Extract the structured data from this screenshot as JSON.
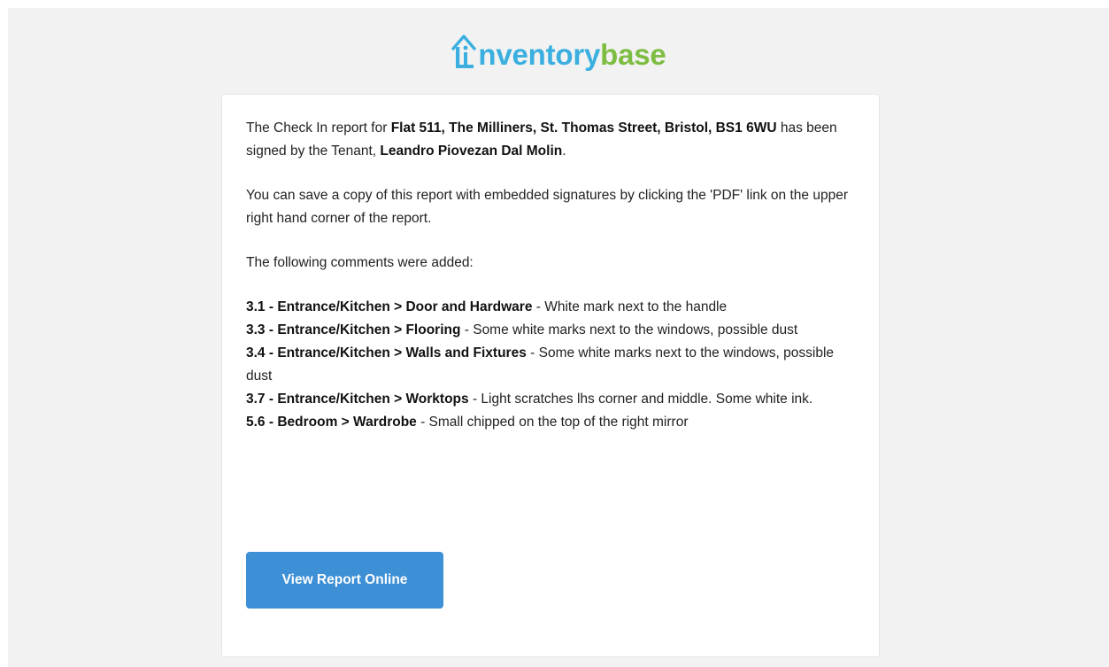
{
  "logo": {
    "part1": "nventory",
    "part2": "base"
  },
  "message": {
    "intro_1": "The Check In report for ",
    "address": "Flat 511, The Milliners, St. Thomas Street, Bristol, BS1 6WU",
    "intro_2": " has been signed by the Tenant, ",
    "tenant": "Leandro Piovezan Dal Molin",
    "intro_3": ".",
    "save_note": "You can save a copy of this report with embedded signatures by clicking the 'PDF' link on the upper right hand corner of the report.",
    "comments_heading": "The following comments were added:",
    "comments": [
      {
        "ref": "3.1 - Entrance/Kitchen > Door and Hardware",
        "text": " - White mark next to the handle"
      },
      {
        "ref": "3.3 - Entrance/Kitchen > Flooring",
        "text": " - Some white marks next to the windows, possible dust"
      },
      {
        "ref": "3.4 - Entrance/Kitchen > Walls and Fixtures",
        "text": " - Some white marks next to the windows, possible dust"
      },
      {
        "ref": "3.7 - Entrance/Kitchen > Worktops",
        "text": " - Light scratches lhs corner and middle. Some white ink."
      },
      {
        "ref": "5.6 - Bedroom > Wardrobe",
        "text": " - Small chipped on the top of the right mirror"
      }
    ]
  },
  "button": {
    "label": "View Report Online"
  },
  "colors": {
    "logo_blue": "#3aafe0",
    "logo_green": "#7dbd42",
    "button": "#3d8fd6"
  }
}
